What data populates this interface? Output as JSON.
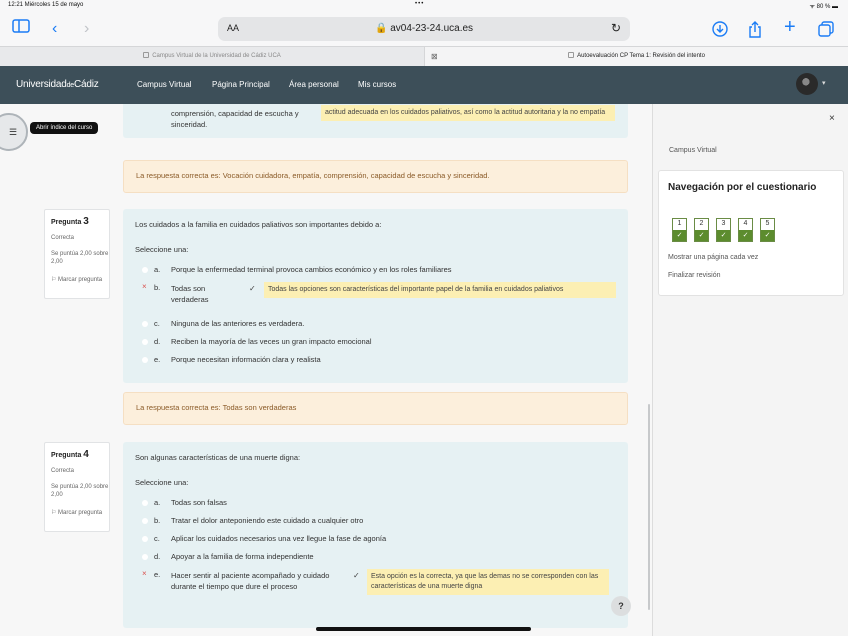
{
  "status_bar": {
    "time_date": "12:21  Miércoles 15 de mayo",
    "dots": "•••",
    "right": "ᯤ 80 % ▬"
  },
  "safari": {
    "sidebar_icon": "sidebar-icon",
    "back_icon": "back-chevron-icon",
    "forward_icon": "forward-chevron-icon",
    "aa": "AA",
    "url": "🔒 av04-23-24.uca.es",
    "reload": "↻",
    "download": "⬇",
    "share": "⇪",
    "new_tab": "+",
    "tabs_icon": "⧉"
  },
  "tabs": [
    {
      "label": "Campus Virtual de la Universidad de Cádiz UCA"
    },
    {
      "label": "Autoevaluación CP Tema 1: Revisión del intento"
    }
  ],
  "topnav": {
    "brand": {
      "part1": "Universidad",
      "de": "de",
      "part2": "Cádiz"
    },
    "links": [
      "Campus Virtual",
      "Página Principal",
      "Área personal",
      "Mis cursos"
    ]
  },
  "course_index": {
    "tooltip": "Abrir índice del curso",
    "icon": "list-icon"
  },
  "q2_tail": {
    "option_text": "comprensión, capacidad de escucha y sinceridad.",
    "feedback": "actitud adecuada en los cuidados paliativos, así como la actitud autoritaria y la no empatía",
    "correct_answer": "La respuesta correcta es: Vocación cuidadora, empatía, comprensión, capacidad de escucha y sinceridad."
  },
  "questions": [
    {
      "label": "Pregunta",
      "number": "3",
      "state": "Correcta",
      "grade": "Se puntúa 2,00 sobre 2,00",
      "flag": "Marcar pregunta",
      "text": "Los cuidados a la familia en cuidados paliativos son importantes debido a:",
      "prompt": "Seleccione una:",
      "options": [
        {
          "letter": "a.",
          "text": "Porque la enfermedad terminal provoca cambios económico y en los roles familiares"
        },
        {
          "letter": "b.",
          "text": "Todas son verdaderas"
        },
        {
          "letter": "c.",
          "text": "Ninguna de las anteriores es verdadera."
        },
        {
          "letter": "d.",
          "text": "Reciben la mayoría de las veces un gran impacto emocional"
        },
        {
          "letter": "e.",
          "text": "Porque necesitan información clara y realista"
        }
      ],
      "feedback": "Todas las opciones son características del importante papel de la familia en cuidados paliativos",
      "correct_answer": "La respuesta correcta es: Todas son verdaderas"
    },
    {
      "label": "Pregunta",
      "number": "4",
      "state": "Correcta",
      "grade": "Se puntúa 2,00 sobre 2,00",
      "flag": "Marcar pregunta",
      "text": "Son algunas características de una muerte digna:",
      "prompt": "Seleccione una:",
      "options": [
        {
          "letter": "a.",
          "text": "Todas son falsas"
        },
        {
          "letter": "b.",
          "text": "Tratar el dolor anteponiendo este cuidado a cualquier otro"
        },
        {
          "letter": "c.",
          "text": "Aplicar los cuidados necesarios una vez llegue la fase de agonía"
        },
        {
          "letter": "d.",
          "text": "Apoyar a la familia de forma independiente"
        },
        {
          "letter": "e.",
          "text": "Hacer sentir al paciente acompañado y cuidado durante el tiempo que dure el proceso"
        }
      ],
      "feedback": "Esta opción es la correcta, ya que las demas no se corresponden con las características de una muerte digna"
    }
  ],
  "drawer": {
    "close": "×",
    "crumb": "Campus Virtual",
    "title": "Navegación por el cuestionario",
    "buttons": [
      "1",
      "2",
      "3",
      "4",
      "5"
    ],
    "check": "✓",
    "show_one_page": "Mostrar una página cada vez",
    "finish_review": "Finalizar revisión"
  },
  "help": "?",
  "colors": {
    "topnav": "#3d4f59",
    "question_bg": "#e6f1f3",
    "feedback_bg": "#fcefb3",
    "answer_bg": "#fcefdc",
    "correct_green": "#5c8c2e"
  }
}
